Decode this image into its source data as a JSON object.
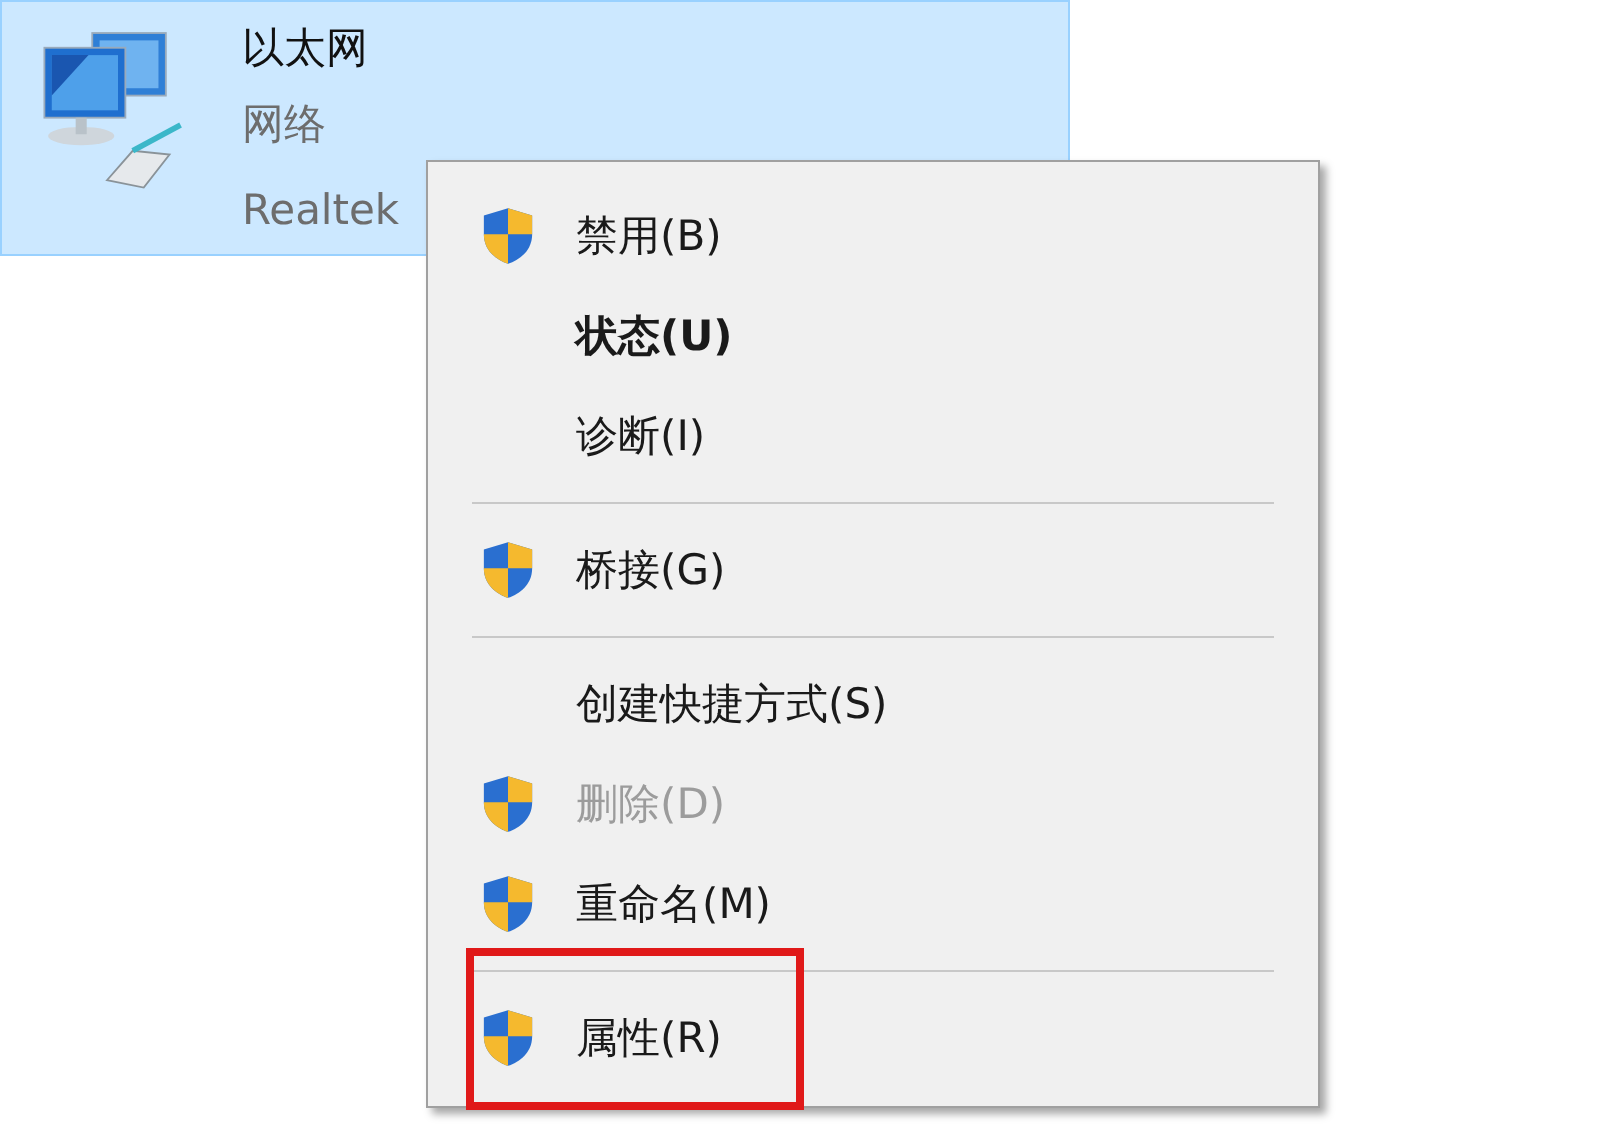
{
  "adapter": {
    "name": "以太网",
    "network": "网络",
    "device": "Realtek",
    "selected": true
  },
  "context_menu": {
    "items": [
      {
        "kind": "item",
        "label": "禁用(B)",
        "shield": true,
        "bold": false,
        "disabled": false,
        "highlighted": false
      },
      {
        "kind": "item",
        "label": "状态(U)",
        "shield": false,
        "bold": true,
        "disabled": false,
        "highlighted": false
      },
      {
        "kind": "item",
        "label": "诊断(I)",
        "shield": false,
        "bold": false,
        "disabled": false,
        "highlighted": false
      },
      {
        "kind": "separator"
      },
      {
        "kind": "item",
        "label": "桥接(G)",
        "shield": true,
        "bold": false,
        "disabled": false,
        "highlighted": false
      },
      {
        "kind": "separator"
      },
      {
        "kind": "item",
        "label": "创建快捷方式(S)",
        "shield": false,
        "bold": false,
        "disabled": false,
        "highlighted": false
      },
      {
        "kind": "item",
        "label": "删除(D)",
        "shield": true,
        "bold": false,
        "disabled": true,
        "highlighted": false
      },
      {
        "kind": "item",
        "label": "重命名(M)",
        "shield": true,
        "bold": false,
        "disabled": false,
        "highlighted": false
      },
      {
        "kind": "separator"
      },
      {
        "kind": "item",
        "label": "属性(R)",
        "shield": true,
        "bold": false,
        "disabled": false,
        "highlighted": true
      }
    ]
  }
}
